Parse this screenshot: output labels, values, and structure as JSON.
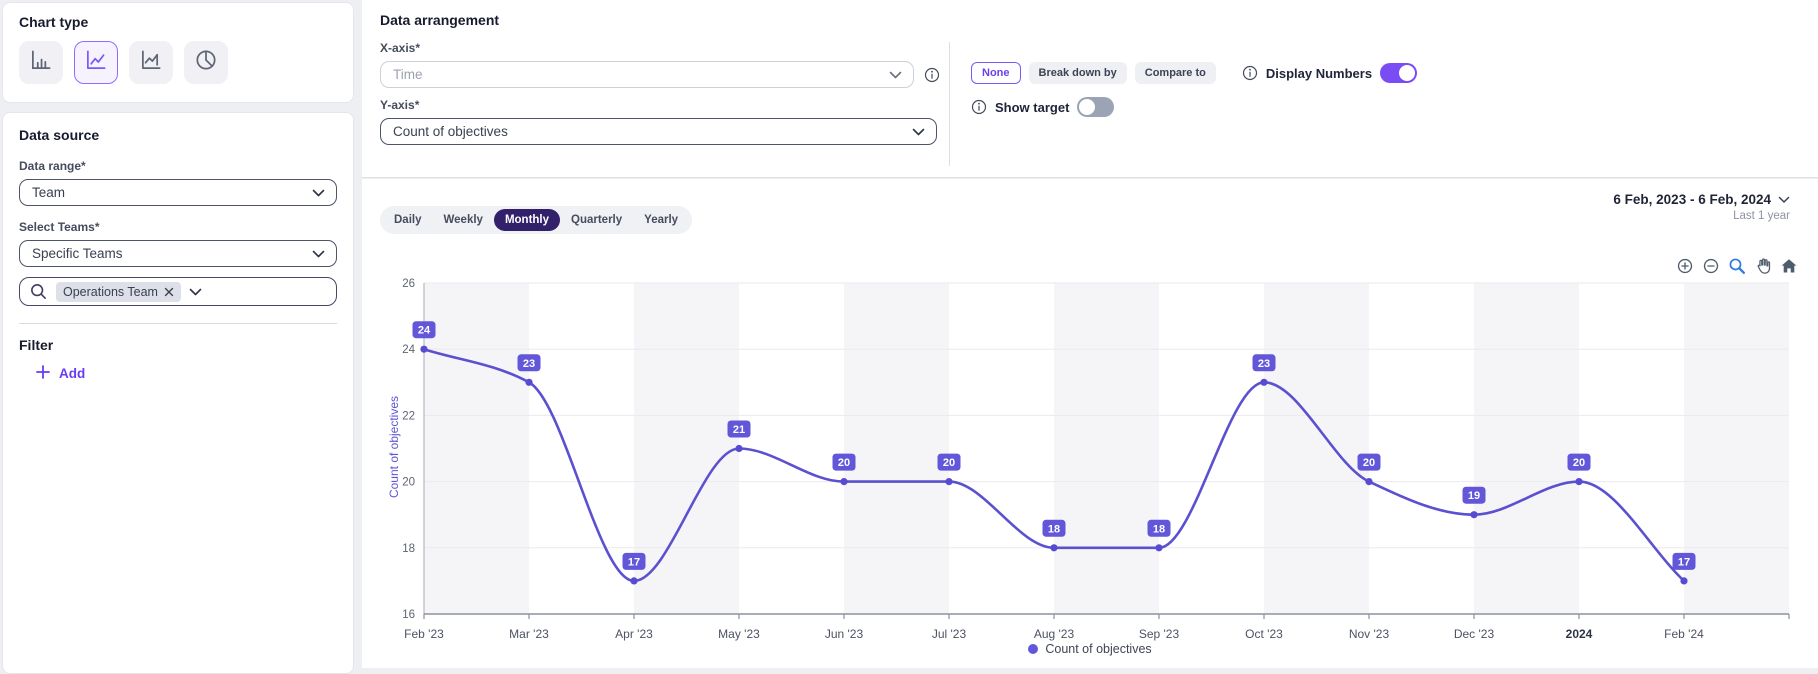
{
  "chart_type_panel": {
    "title": "Chart type",
    "selected_index": 1,
    "options": [
      {
        "name": "bar-chart"
      },
      {
        "name": "line-chart"
      },
      {
        "name": "stepped-line-chart"
      },
      {
        "name": "pie-chart"
      }
    ]
  },
  "data_source": {
    "title": "Data source",
    "data_range_label": "Data range*",
    "data_range_value": "Team",
    "select_teams_label": "Select Teams*",
    "select_teams_value": "Specific Teams",
    "team_chip": "Operations Team",
    "filter_title": "Filter",
    "add_label": "Add"
  },
  "data_arrangement": {
    "title": "Data arrangement",
    "x_axis_label": "X-axis*",
    "x_axis_value": "Time",
    "y_axis_label": "Y-axis*",
    "y_axis_value": "Count of objectives"
  },
  "breakdown_controls": {
    "none_label": "None",
    "break_down_by_label": "Break down by",
    "compare_to_label": "Compare to",
    "display_numbers_label": "Display Numbers",
    "display_numbers_on": true,
    "show_target_label": "Show target",
    "show_target_on": false
  },
  "period_tabs": {
    "items": [
      "Daily",
      "Weekly",
      "Monthly",
      "Quarterly",
      "Yearly"
    ],
    "selected": "Monthly"
  },
  "date_range": {
    "label": "6 Feb, 2023 - 6 Feb, 2024",
    "sub": "Last 1 year"
  },
  "toolbar_icons": [
    "zoom-in",
    "zoom-out",
    "box-zoom",
    "pan",
    "home"
  ],
  "chart_data": {
    "type": "line",
    "x": [
      "Feb '23",
      "Mar '23",
      "Apr '23",
      "May '23",
      "Jun '23",
      "Jul '23",
      "Aug '23",
      "Sep '23",
      "Oct '23",
      "Nov '23",
      "Dec '23",
      "2024",
      "Feb '24"
    ],
    "bold_labels": [
      "2024"
    ],
    "series": [
      {
        "name": "Count of objectives",
        "values": [
          24,
          23,
          17,
          21,
          20,
          20,
          18,
          18,
          23,
          20,
          19,
          20,
          17
        ]
      }
    ],
    "ylabel": "Count of objectives",
    "ylim": [
      16,
      26
    ],
    "yticks": [
      16,
      18,
      20,
      22,
      24,
      26
    ],
    "grid": true,
    "legend_position": "bottom-center",
    "smooth": true,
    "data_labels": true,
    "line_color": "#5b50cf",
    "marker_color": "#574cd1",
    "label_badge_color": "#6257d9",
    "band_color": "#f5f5f8"
  },
  "colors": {
    "accent_purple": "#6a3bf5",
    "selected_tab_bg": "#32206a",
    "toggle_on": "#7a4cf4",
    "toolbar_active_blue": "#2b7de0",
    "page_bg": "#edeff3"
  }
}
